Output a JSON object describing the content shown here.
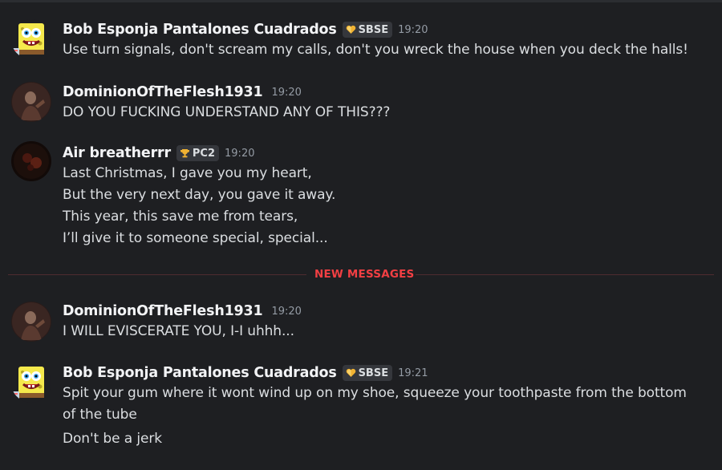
{
  "messages": [
    {
      "username": "Bob Esponja Pantalones Cuadrados",
      "avatar_icon": "sponge-avatar",
      "tag_icon": "heart-icon",
      "tag": "SBSE",
      "time": "19:20",
      "lines": [
        "Use turn signals, don't scream my calls, don't you wreck the house when you deck the halls!"
      ]
    },
    {
      "username": "DominionOfTheFlesh1931",
      "avatar_icon": "dark-figure-avatar",
      "time": "19:20",
      "lines": [
        "DO YOU FUCKING UNDERSTAND ANY OF THIS???"
      ]
    },
    {
      "username": "Air breatherrr",
      "avatar_icon": "dark-red-avatar",
      "tag_icon": "trophy-icon",
      "tag": "PC2",
      "time": "19:20",
      "lines": [
        "Last Christmas, I gave you my heart,",
        "But the very next day, you gave it away.",
        "This year, this save me from tears,",
        "I’ll give it to someone special, special..."
      ]
    },
    {
      "username": "DominionOfTheFlesh1931",
      "avatar_icon": "dark-figure-avatar",
      "time": "19:20",
      "lines": [
        "I WILL EVISCERATE YOU, I-I uhhh..."
      ]
    },
    {
      "username": "Bob Esponja Pantalones Cuadrados",
      "avatar_icon": "sponge-avatar",
      "tag_icon": "heart-icon",
      "tag": "SBSE",
      "time": "19:21",
      "lines": [
        "Spit your gum where it wont wind up on my shoe, squeeze your toothpaste from the bottom",
        "of the tube",
        "Don't be a jerk"
      ]
    }
  ],
  "divider": {
    "label": "NEW MESSAGES",
    "color": "#f23f43"
  },
  "colors": {
    "background": "#1e1f22",
    "username": "#f2f3f5",
    "text": "#dbdee1",
    "timestamp": "#949ba4",
    "tag_bg": "#35373c"
  }
}
